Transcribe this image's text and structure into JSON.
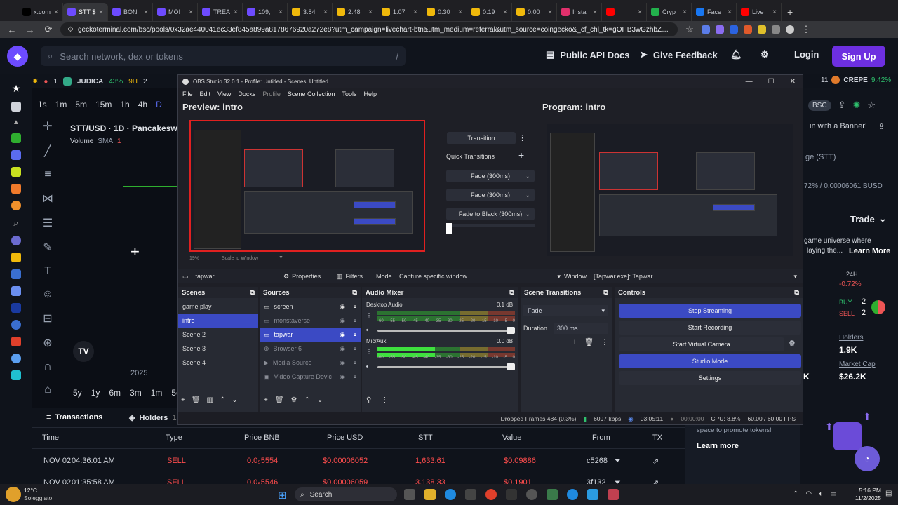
{
  "browser": {
    "tabs": [
      {
        "label": "x.com",
        "color": "#000000"
      },
      {
        "label": "STT $",
        "color": "#6d4bff",
        "active": true
      },
      {
        "label": "BON",
        "color": "#6d4bff"
      },
      {
        "label": "MO!",
        "color": "#6d4bff"
      },
      {
        "label": "TREA",
        "color": "#6d4bff"
      },
      {
        "label": "109,",
        "color": "#6d4bff"
      },
      {
        "label": "3.84",
        "color": "#f0b90b"
      },
      {
        "label": "2.48",
        "color": "#f0b90b"
      },
      {
        "label": "1.07",
        "color": "#f0b90b"
      },
      {
        "label": "0.30",
        "color": "#f0b90b"
      },
      {
        "label": "0.19",
        "color": "#f0b90b"
      },
      {
        "label": "0.00",
        "color": "#f0b90b"
      },
      {
        "label": "Insta",
        "color": "#e1306c"
      },
      {
        "label": "",
        "color": "#ff0000"
      },
      {
        "label": "Cryp",
        "color": "#22b14c"
      },
      {
        "label": "Face",
        "color": "#1877f2"
      },
      {
        "label": "Live",
        "color": "#ff0000"
      }
    ],
    "url": "geckoterminal.com/bsc/pools/0x32ae440041ec33ef845a899a8178676920a272e8?utm_campaign=livechart-btn&utm_medium=referral&utm_source=coingecko&_cf_chl_tk=gOHB3wGzhbZapqT5ryoLwHaX6sL..."
  },
  "site": {
    "search_placeholder": "Search network, dex or tokens",
    "search_shortcut": "/",
    "api_docs": "Public API Docs",
    "feedback": "Give Feedback",
    "login": "Login",
    "signup": "Sign Up",
    "ticker": {
      "rank1": "1",
      "token1": "JUDICA",
      "pct1": "43%",
      "pos1": "9H",
      "rank2": "2",
      "rank_right": "11",
      "token_right": "CREPE",
      "pct_right": "9.42%"
    },
    "chart": {
      "timeframes": [
        "1s",
        "1m",
        "5m",
        "15m",
        "1h",
        "4h",
        "D"
      ],
      "pair": "STT/USD · 1D · Pancakesw",
      "volume": "Volume",
      "sma": "SMA",
      "sma_val": "1",
      "year": "2025",
      "ranges": [
        "5y",
        "1y",
        "6m",
        "3m",
        "1m",
        "5d"
      ]
    },
    "right": {
      "chain": "BSC",
      "banner": "in with a Banner!",
      "name": "ge (STT)",
      "price": "72% / 0.00006061 BUSD",
      "trade": "Trade",
      "promo1": "game universe where",
      "promo2": "laying the...",
      "learn_more": "Learn More",
      "h24": "24H",
      "h24_val": "-0.72%",
      "buy": "BUY",
      "buy_n": "2",
      "sell": "SELL",
      "sell_n": "2",
      "holders": "Holders",
      "holders_val": "1.9K",
      "mcap": "Market Cap",
      "mcap_val": "$26.2K",
      "k": "K",
      "promote": "space to promote tokens!",
      "learn_more2": "Learn more"
    },
    "tx": {
      "tabs": {
        "transactions": "Transactions",
        "holders": "Holders",
        "holders_count": "1,8"
      },
      "headers": [
        "Time",
        "Type",
        "Price BNB",
        "Price USD",
        "STT",
        "Value",
        "From",
        "TX"
      ],
      "rows": [
        {
          "date": "NOV 02",
          "time": "04:36:01 AM",
          "type": "SELL",
          "bnb": "0.0₅5554",
          "usd": "$0.00006052",
          "stt": "1,633.61",
          "value": "$0.09886",
          "from": "c5268"
        },
        {
          "date": "NOV 02",
          "time": "01:35:58 AM",
          "type": "SELL",
          "bnb": "0.0₅5546",
          "usd": "$0.00006059",
          "stt": "3,138.33",
          "value": "$0.1901",
          "from": "3f132"
        }
      ]
    }
  },
  "obs": {
    "title": "OBS Studio 32.0.1 - Profile: Untitled - Scenes: Untitled",
    "menu": [
      "File",
      "Edit",
      "View",
      "Docks",
      "Profile",
      "Scene Collection",
      "Tools",
      "Help"
    ],
    "preview_title": "Preview: intro",
    "program_title": "Program: intro",
    "transition": "Transition",
    "quick_transitions": "Quick Transitions",
    "qt": [
      "Fade (300ms)",
      "Fade (300ms)",
      "Fade to Black (300ms)"
    ],
    "zoom": "19%",
    "scale": "Scale to Window",
    "source_bar": {
      "name": "tapwar",
      "properties": "Properties",
      "filters": "Filters",
      "mode_label": "Mode",
      "mode": "Capture specific window",
      "window_label": "Window",
      "window": "[Tapwar.exe]: Tapwar"
    },
    "scenes": {
      "title": "Scenes",
      "items": [
        "game play",
        "intro",
        "Scene 2",
        "Scene 3",
        "Scene 4"
      ],
      "selected": 1
    },
    "sources": {
      "title": "Sources",
      "items": [
        "screen",
        "monstaverse",
        "tapwar",
        "Browser 6",
        "Media Source",
        "Video Capture Devic"
      ],
      "selected": 2
    },
    "mixer": {
      "title": "Audio Mixer",
      "ch1": {
        "name": "Desktop Audio",
        "db": "0.1 dB",
        "level": 0.0
      },
      "ch2": {
        "name": "Mic/Aux",
        "db": "0.0 dB",
        "level": 0.42
      },
      "scale": [
        "-60",
        "-55",
        "-50",
        "-45",
        "-40",
        "-35",
        "-30",
        "-25",
        "-20",
        "-15",
        "-10",
        "-5",
        "0"
      ]
    },
    "transitions": {
      "title": "Scene Transitions",
      "type": "Fade",
      "duration_label": "Duration",
      "duration": "300 ms"
    },
    "controls": {
      "title": "Controls",
      "stop_streaming": "Stop Streaming",
      "start_recording": "Start Recording",
      "virtual_cam": "Start Virtual Camera",
      "studio_mode": "Studio Mode",
      "settings": "Settings"
    },
    "status": {
      "dropped": "Dropped Frames 484 (0.3%)",
      "kbps": "6097 kbps",
      "live": "03:05:11",
      "rec": "00:00:00",
      "cpu": "CPU: 8.8%",
      "fps": "60.00 / 60.00 FPS"
    }
  },
  "taskbar": {
    "weather_temp": "12°C",
    "weather_desc": "Soleggiato",
    "search": "Search",
    "time": "5:16 PM",
    "date": "11/2/2025"
  }
}
